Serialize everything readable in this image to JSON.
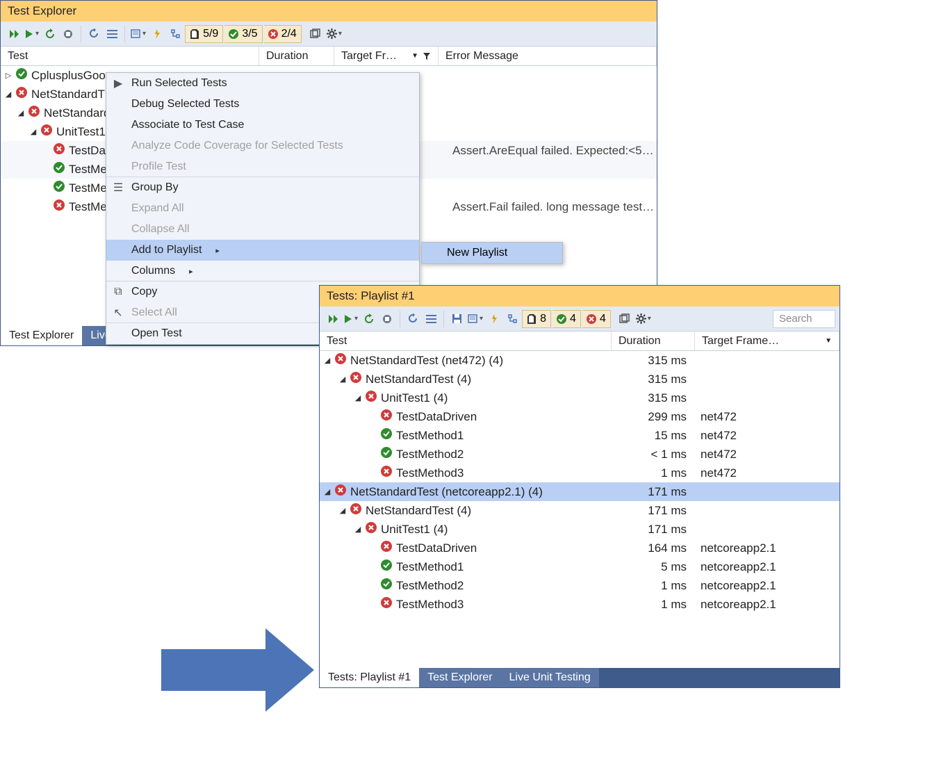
{
  "window1": {
    "title": "Test Explorer",
    "counters": {
      "notrun": "5/9",
      "passed": "3/5",
      "failed": "2/4"
    },
    "columns": {
      "test": "Test",
      "duration": "Duration",
      "target": "Target Fr…",
      "error": "Error Message"
    },
    "tree": [
      {
        "indent": 0,
        "caret": "▷",
        "status": "pass",
        "label": "CplusplusGoo"
      },
      {
        "indent": 0,
        "caret": "◢",
        "status": "fail",
        "label": "NetStandardT"
      },
      {
        "indent": 1,
        "caret": "◢",
        "status": "fail",
        "label": "NetStandard"
      },
      {
        "indent": 2,
        "caret": "◢",
        "status": "fail",
        "label": "UnitTest1"
      },
      {
        "indent": 3,
        "caret": "",
        "status": "fail",
        "label": "TestData",
        "error": "Assert.AreEqual failed. Expected:<5…",
        "shade": true
      },
      {
        "indent": 3,
        "caret": "",
        "status": "pass",
        "label": "TestMet",
        "shade": true
      },
      {
        "indent": 3,
        "caret": "",
        "status": "pass",
        "label": "TestMet"
      },
      {
        "indent": 3,
        "caret": "",
        "status": "fail",
        "label": "TestMet",
        "error": "Assert.Fail failed. long message test…"
      }
    ],
    "status_tabs": {
      "active": "Test Explorer",
      "other": "Live"
    }
  },
  "context_menu": {
    "items": [
      {
        "label": "Run Selected Tests",
        "glyph": "▶"
      },
      {
        "label": "Debug Selected Tests"
      },
      {
        "label": "Associate to Test Case"
      },
      {
        "label": "Analyze Code Coverage for Selected Tests",
        "disabled": true
      },
      {
        "label": "Profile Test",
        "disabled": true,
        "sep": true
      },
      {
        "label": "Group By",
        "glyph": "☰"
      },
      {
        "label": "Expand All",
        "disabled": true
      },
      {
        "label": "Collapse All",
        "disabled": true
      },
      {
        "label": "Add to Playlist",
        "submenu": true,
        "highlight": true
      },
      {
        "label": "Columns",
        "submenu": true,
        "sep": true
      },
      {
        "label": "Copy",
        "glyph": "⧉"
      },
      {
        "label": "Select All",
        "disabled": true,
        "glyph": "↖",
        "sep": true
      },
      {
        "label": "Open Test"
      }
    ],
    "submenu_label": "New Playlist"
  },
  "window2": {
    "title": "Tests: Playlist #1",
    "counters": {
      "notrun": "8",
      "passed": "4",
      "failed": "4"
    },
    "search_placeholder": "Search",
    "columns": {
      "test": "Test",
      "duration": "Duration",
      "target": "Target Frame…"
    },
    "tree": [
      {
        "indent": 0,
        "caret": "◢",
        "status": "fail",
        "label": "NetStandardTest (net472)  (4)",
        "dur": "315 ms"
      },
      {
        "indent": 1,
        "caret": "◢",
        "status": "fail",
        "label": "NetStandardTest  (4)",
        "dur": "315 ms"
      },
      {
        "indent": 2,
        "caret": "◢",
        "status": "fail",
        "label": "UnitTest1  (4)",
        "dur": "315 ms"
      },
      {
        "indent": 3,
        "caret": "",
        "status": "fail",
        "label": "TestDataDriven",
        "dur": "299 ms",
        "tgt": "net472"
      },
      {
        "indent": 3,
        "caret": "",
        "status": "pass",
        "label": "TestMethod1",
        "dur": "15 ms",
        "tgt": "net472"
      },
      {
        "indent": 3,
        "caret": "",
        "status": "pass",
        "label": "TestMethod2",
        "dur": "< 1 ms",
        "tgt": "net472"
      },
      {
        "indent": 3,
        "caret": "",
        "status": "fail",
        "label": "TestMethod3",
        "dur": "1 ms",
        "tgt": "net472"
      },
      {
        "indent": 0,
        "caret": "◢",
        "status": "fail",
        "label": "NetStandardTest (netcoreapp2.1)  (4)",
        "dur": "171 ms",
        "sel": true
      },
      {
        "indent": 1,
        "caret": "◢",
        "status": "fail",
        "label": "NetStandardTest  (4)",
        "dur": "171 ms"
      },
      {
        "indent": 2,
        "caret": "◢",
        "status": "fail",
        "label": "UnitTest1  (4)",
        "dur": "171 ms"
      },
      {
        "indent": 3,
        "caret": "",
        "status": "fail",
        "label": "TestDataDriven",
        "dur": "164 ms",
        "tgt": "netcoreapp2.1"
      },
      {
        "indent": 3,
        "caret": "",
        "status": "pass",
        "label": "TestMethod1",
        "dur": "5 ms",
        "tgt": "netcoreapp2.1"
      },
      {
        "indent": 3,
        "caret": "",
        "status": "pass",
        "label": "TestMethod2",
        "dur": "1 ms",
        "tgt": "netcoreapp2.1"
      },
      {
        "indent": 3,
        "caret": "",
        "status": "fail",
        "label": "TestMethod3",
        "dur": "1 ms",
        "tgt": "netcoreapp2.1"
      }
    ],
    "status_tabs": {
      "active": "Tests: Playlist #1",
      "mid": "Test Explorer",
      "other": "Live Unit Testing"
    }
  }
}
